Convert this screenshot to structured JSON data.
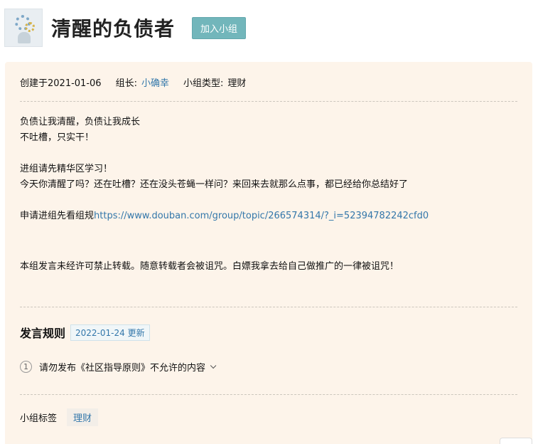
{
  "group": {
    "title": "清醒的负债者",
    "join_label": "加入小组"
  },
  "meta": {
    "created": "创建于2021-01-06",
    "leader_label": "组长:",
    "leader_name": "小确幸",
    "type_label": "小组类型:",
    "type_value": "理财"
  },
  "intro": {
    "line1": "负债让我清醒，负债让我成长",
    "line2": "不吐槽，只实干！",
    "line3": "进组请先精华区学习！",
    "line4": "今天你清醒了吗？还在吐槽？还在没头苍蝇一样问？来回来去就那么点事，都已经给你总结好了",
    "line5_prefix": "申请进组先看组规",
    "line5_link": "https://www.douban.com/group/topic/266574314/?_i=52394782242cfd0",
    "line6": "本组发言未经许可禁止转载。随意转载者会被诅咒。白嫖我拿去给自己做推广的一律被诅咒！"
  },
  "rules": {
    "title": "发言规则",
    "updated": "2022-01-24 更新",
    "items": [
      {
        "num": "1",
        "text": "请勿发布《社区指导原则》不允许的内容"
      }
    ]
  },
  "tags": {
    "label": "小组标签",
    "items": [
      "理财"
    ]
  }
}
